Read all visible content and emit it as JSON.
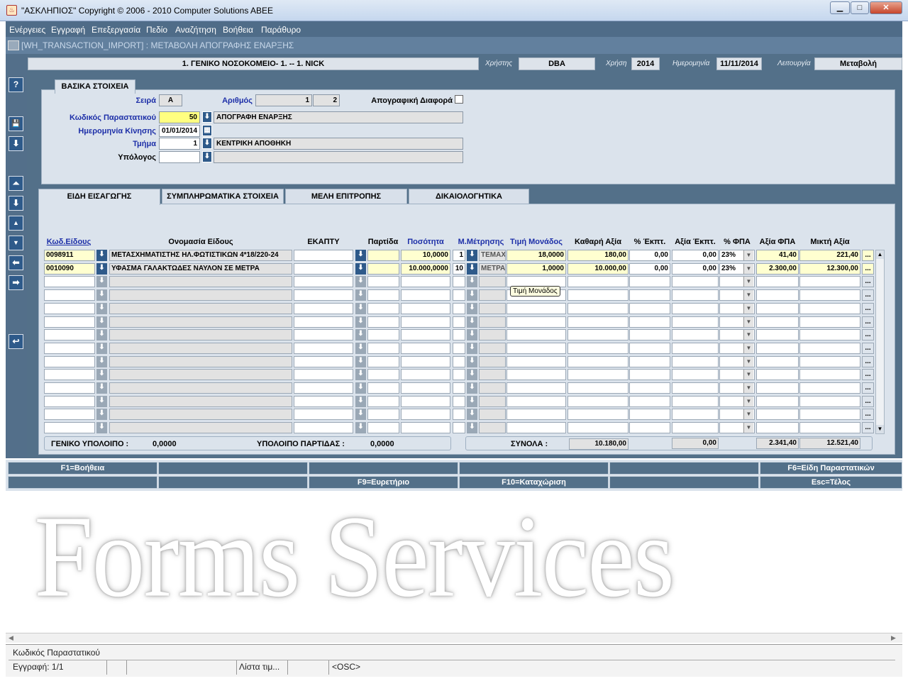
{
  "window": {
    "title": "\"ΑΣΚΛΗΠΙΟΣ\" Copyright © 2006 - 2010 Computer Solutions ABEE",
    "minimize": "▁",
    "maximize": "□",
    "close": "✕"
  },
  "menu": [
    "Ενέργειες",
    "Εγγραφή",
    "Επεξεργασία",
    "Πεδίο",
    "Αναζήτηση",
    "Βοήθεια",
    "Παράθυρο"
  ],
  "form_title": "[WH_TRANSACTION_IMPORT]  :  ΜΕΤΑΒΟΛΗ ΑΠΟΓΡΑΦΗΣ ΕΝΑΡΞΗΣ",
  "header": {
    "company": "1. ΓΕΝΙΚΟ ΝΟΣΟΚΟΜΕΙΟ- 1. -- 1. NICK",
    "user_label": "Χρήστης",
    "user": "DBA",
    "year_label": "Χρήση",
    "year": "2014",
    "date_label": "Ημερομηνία",
    "date": "11/11/2014",
    "mode_label": "Λειτουργία",
    "mode": "Μεταβολή"
  },
  "toolbar": {
    "help": "?",
    "save": "💾",
    "down": "⬇",
    "first": "⏶",
    "next": "⬇",
    "up": "▲",
    "down2": "▼",
    "left": "⬅",
    "right": "➡",
    "undo": "↩"
  },
  "basic": {
    "section_title": "ΒΑΣΙΚΑ ΣΤΟΙΧΕΙΑ",
    "series_label": "Σειρά",
    "series": "Α",
    "number_label": "Αριθμός",
    "number": "1",
    "number2": "2",
    "diff_label": "Απογραφική Διαφορά",
    "doc_code_label": "Κωδικός Παραστατικού",
    "doc_code": "50",
    "doc_name": "ΑΠΟΓΡΑΦΗ ΕΝΑΡΞΗΣ",
    "move_date_label": "Ημερομηνία Κίνησης",
    "move_date": "01/01/2014",
    "dept_label": "Τμήμα",
    "dept": "1",
    "dept_name": "ΚΕΝΤΡΙΚΗ ΑΠΟΘΗΚΗ",
    "resp_label": "Υπόλογος",
    "resp": "",
    "resp_name": ""
  },
  "tabs": [
    "ΕΙΔΗ ΕΙΣΑΓΩΓΗΣ",
    "ΣΥΜΠΛΗΡΩΜΑΤΙΚΑ ΣΤΟΙΧΕΙΑ",
    "ΜΕΛΗ ΕΠΙΤΡΟΠΗΣ",
    "ΔΙΚΑΙΟΛΟΓΗΤΙΚΑ"
  ],
  "columns": {
    "code": "Κωδ.Είδους",
    "name": "Ονομασία Είδους",
    "ekapty": "ΕΚΑΠΤΥ",
    "lot": "Παρτίδα",
    "qty": "Ποσότητα",
    "unit": "Μ.Μέτρησης",
    "price": "Τιμή Μονάδος",
    "net": "Καθαρή Αξία",
    "disc_pct": "% Έκπτ.",
    "disc_val": "Αξία Έκπτ.",
    "vat_pct": "% ΦΠΑ",
    "vat_val": "Αξία  ΦΠΑ",
    "gross": "Μικτή Αξία"
  },
  "rows": [
    {
      "code": "0098911",
      "name": "ΜΕΤΑΣΧΗΜΑΤΙΣΤΗΣ ΗΛ.ΦΩΤΙΣΤΙΚΩΝ 4*18/220-24",
      "ekapty": "",
      "lot": "",
      "qty": "10,0000",
      "unit_no": "1",
      "unit": "ΤΕΜΑΧ",
      "price": "18,0000",
      "net": "180,00",
      "disc_pct": "0,00",
      "disc_val": "0,00",
      "vat_pct": "23%",
      "vat_val": "41,40",
      "gross": "221,40",
      "more": "..."
    },
    {
      "code": "0010090",
      "name": "ΥΦΑΣΜΑ ΓΑΛΑΚΤΩΔΕΣ ΝΑΥΛΟΝ ΣΕ ΜΕΤΡΑ",
      "ekapty": "",
      "lot": "",
      "qty": "10.000,0000",
      "unit_no": "10",
      "unit": "ΜΕΤΡΑ",
      "price": "1,0000",
      "net": "10.000,00",
      "disc_pct": "0,00",
      "disc_val": "0,00",
      "vat_pct": "23%",
      "vat_val": "2.300,00",
      "gross": "12.300,00",
      "more": "..."
    }
  ],
  "tooltip": "Τιμή Μονάδος",
  "totals": {
    "general_balance_label": "ΓΕΝΙΚΟ ΥΠΟΛΟΙΠΟ :",
    "general_balance": "0,0000",
    "lot_balance_label": "ΥΠΟΛΟΙΠΟ ΠΑΡΤΙΔΑΣ :",
    "lot_balance": "0,0000",
    "sums_label": "ΣΥΝΟΛΑ :",
    "net": "10.180,00",
    "disc": "0,00",
    "vat": "2.341,40",
    "gross": "12.521,40"
  },
  "fkeys_row1": [
    "F1=Βοήθεια",
    "",
    "",
    "",
    "",
    "F6=Είδη Παραστατικών"
  ],
  "fkeys_row2": [
    "",
    "",
    "F9=Ευρετήριο",
    "F10=Καταχώριση",
    "",
    "Esc=Τέλος"
  ],
  "watermark": "Forms Services",
  "status": {
    "field": "Κωδικός Παραστατικού",
    "record": "Εγγραφή: 1/1",
    "list": "Λίστα τιμ...",
    "osc": "<OSC>"
  }
}
